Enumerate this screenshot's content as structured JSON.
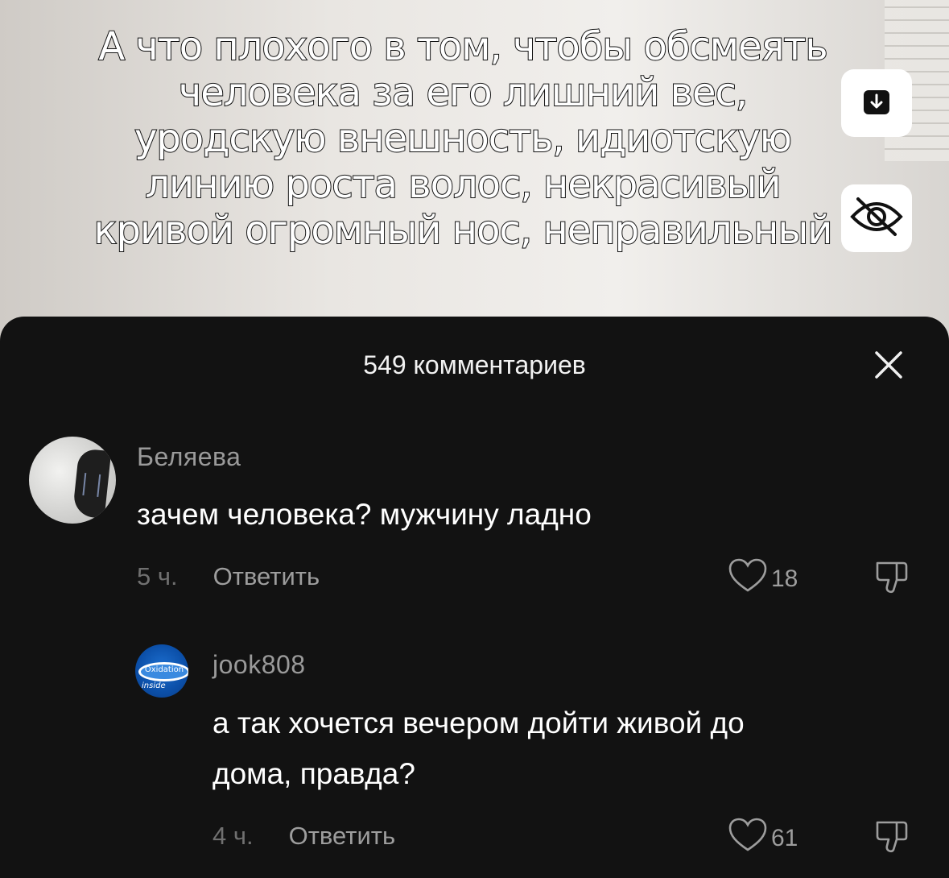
{
  "video": {
    "overlay_lines": [
      "А что плохого в том, чтобы обсмеять",
      "человека за его лишний вес,",
      "уродскую внешность, идиотскую",
      "линию роста волос, некрасивый",
      "кривой огромный нос, неправильный"
    ],
    "download_icon": "download-icon",
    "hide_icon": "eye-off-icon"
  },
  "comments_sheet": {
    "title": "549 комментариев",
    "close_icon": "close-icon",
    "comments": [
      {
        "username": "Беляева",
        "text": "зачем человека? мужчину ладно",
        "time": "5 ч.",
        "reply_label": "Ответить",
        "likes": "18"
      },
      {
        "username": "jook808",
        "avatar_text": [
          "Oxidation",
          "inside"
        ],
        "text_lines": [
          "а так хочется вечером дойти живой до",
          "дома, правда?"
        ],
        "time": "4 ч.",
        "reply_label": "Ответить",
        "likes": "61"
      }
    ]
  },
  "colors": {
    "sheet_background": "#121212",
    "username": "#9a9a9a",
    "meta": "#9d9d9d"
  }
}
